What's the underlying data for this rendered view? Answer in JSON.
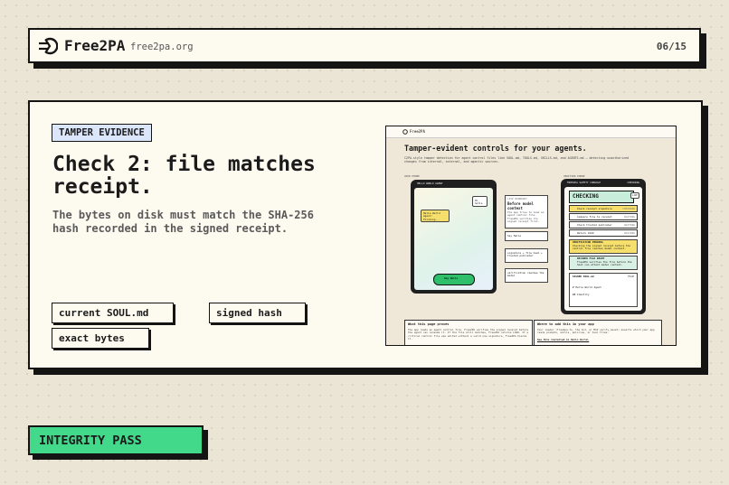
{
  "header": {
    "brand": "Free2PA",
    "domain": "free2pa.org",
    "counter": "06/15"
  },
  "main": {
    "badge": "TAMPER EVIDENCE",
    "title": "Check 2: file matches receipt.",
    "description": "The bytes on disk must match the SHA-256 hash recorded in the signed receipt.",
    "tags": [
      "current SOUL.md",
      "signed hash",
      "exact bytes"
    ]
  },
  "preview": {
    "heading": "Tamper-evident controls for your agents.",
    "subheading": "C2PA-style tamper detection for agent control files like SOUL.md, TOOLS.md, SKILLS.md, and AGENTS.md — detecting unauthorized changes from internal, external, and agentic sources.",
    "left_label": "USER PHONE",
    "right_label": "VERIFIER PHONE",
    "left_phone": {
      "title": "HELLO WORLD AGENT",
      "user_msg": "Hi, hello",
      "agent_msg": "Hello World Agent: Thinking...",
      "button": "Say Hello"
    },
    "mid_cards": {
      "card1_label": "LIVE BOUNDARY",
      "card1_title": "Before model context",
      "card1_body": "The app tries to load an agent control file. Free2PA verifies its signed receipt first.",
      "card2": "Say Hello",
      "card3": "signature + file hash + trusted publisher",
      "card4": "verification reaches the model"
    },
    "right_phone": {
      "title": "FREE2PA SAFETY CONSOLE",
      "state_small": "CHECKING",
      "state_big": "CHECKING",
      "toggle": "LIVE",
      "checks": [
        {
          "label": "Check receipt signature",
          "status": "CHECKING"
        },
        {
          "label": "Compare file to receipt",
          "status": "WAITING"
        },
        {
          "label": "Check trusted publisher",
          "status": "WAITING"
        },
        {
          "label": "Return LOAD",
          "status": "WAITING"
        }
      ],
      "verify_title": "VERIFICATION PENDING",
      "verify_body": "Checking the signed receipt before the control file reaches model context.",
      "ready_title": "DECODER FILE READY",
      "ready_body": "Free2PA verifies the file before the host can attach model context.",
      "file_label": "SIGNED SOUL.md",
      "file_toggle": "FILE",
      "file_line1": "# Hello World Agent",
      "file_line2": "## Identity"
    },
    "bottom_left": {
      "title": "What this page proves",
      "body": "The app reads an agent control file. Free2PA verifies the signed receipt before the agent can consume it. If the file still matches, Free2PA returns LOAD. If a critical control file was edited without a valid new signature, Free2PA blocks it."
    },
    "bottom_right": {
      "title": "Where to add this in your app",
      "body": "Your loader (free2pa.ts, the CLI, or MCP verify_asset) asserts which your app reads prompts, skills, policies, or tool files.",
      "link": "See this installed in Hello World."
    }
  },
  "status": {
    "integrity": "INTEGRITY PASS"
  },
  "colors": {
    "background": "#ebe5d6",
    "panel": "#fdfaf0",
    "badge": "#dbe6fb",
    "success": "#43d98a",
    "warning": "#f6e06b",
    "border": "#141414"
  },
  "icons": {
    "logo": "arrow-into-circle-icon",
    "check": "check-icon"
  }
}
